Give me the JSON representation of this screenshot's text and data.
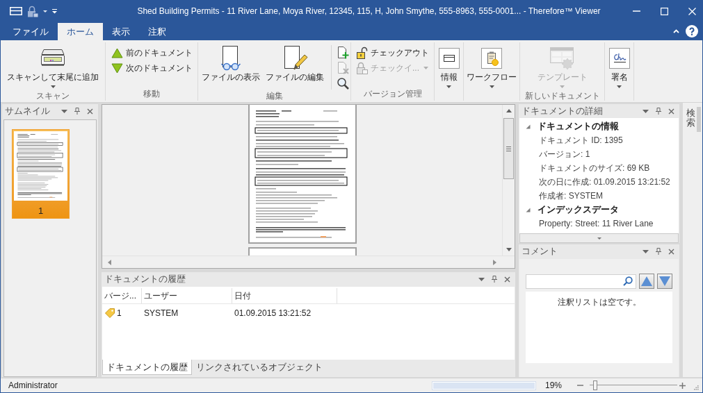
{
  "window": {
    "title": "Shed Building Permits - 11 River Lane, Moya River, 12345, 115, H, John Smythe, 555-8963, 555-0001... - Therefore™ Viewer"
  },
  "ribbon_tabs": [
    {
      "label": "ファイル",
      "selected": false
    },
    {
      "label": "ホーム",
      "selected": true
    },
    {
      "label": "表示",
      "selected": false
    },
    {
      "label": "注釈",
      "selected": false
    }
  ],
  "ribbon_groups": [
    {
      "label": "スキャン",
      "buttons": [
        {
          "kind": "large",
          "label": "スキャンして末尾に追加",
          "dropdown": true,
          "disabled": false
        }
      ]
    },
    {
      "label": "移動",
      "buttons": [
        {
          "kind": "small",
          "label": "前のドキュメント",
          "dropdown": false,
          "disabled": false
        },
        {
          "kind": "small",
          "label": "次のドキュメント",
          "dropdown": false,
          "disabled": false
        }
      ]
    },
    {
      "label": "編集",
      "buttons": [
        {
          "kind": "large",
          "label": "ファイルの表示",
          "dropdown": false,
          "disabled": false
        },
        {
          "kind": "large",
          "label": "ファイルの編集",
          "dropdown": false,
          "disabled": false
        },
        {
          "kind": "icon",
          "dropdown": false,
          "disabled": false
        },
        {
          "kind": "icon",
          "dropdown": false,
          "disabled": true
        },
        {
          "kind": "icon",
          "dropdown": false,
          "disabled": false
        }
      ]
    },
    {
      "label": "バージョン管理",
      "buttons": [
        {
          "kind": "small",
          "label": "チェックアウト",
          "dropdown": false,
          "disabled": false
        },
        {
          "kind": "small",
          "label": "チェックイ...",
          "dropdown": true,
          "disabled": true
        }
      ]
    },
    {
      "buttons": [
        {
          "kind": "large",
          "label": "情報",
          "dropdown": true,
          "disabled": false
        }
      ]
    },
    {
      "buttons": [
        {
          "kind": "large",
          "label": "ワークフロー",
          "dropdown": true,
          "disabled": false
        }
      ]
    },
    {
      "label": "新しいドキュメント",
      "buttons": [
        {
          "kind": "large",
          "label": "テンプレート",
          "dropdown": true,
          "disabled": true
        }
      ]
    },
    {
      "buttons": [
        {
          "kind": "large",
          "label": "署名",
          "dropdown": true,
          "disabled": false
        }
      ]
    }
  ],
  "thumbnails": {
    "title": "サムネイル",
    "pages": [
      {
        "label": "1",
        "selected": true
      }
    ]
  },
  "history": {
    "title": "ドキュメントの履歴",
    "columns": [
      "バージ...",
      "ユーザー",
      "日付"
    ],
    "rows": [
      [
        "1",
        "SYSTEM",
        "01.09.2015 13:21:52"
      ]
    ],
    "tabs": [
      {
        "label": "ドキュメントの履歴",
        "selected": true
      },
      {
        "label": "リンクされているオブジェクト",
        "selected": false
      }
    ]
  },
  "details": {
    "title": "ドキュメントの詳細",
    "tree": [
      {
        "label": "ドキュメントの情報",
        "expanded": true,
        "children": [
          {
            "label": "ドキュメント ID: 1395"
          },
          {
            "label": "バージョン: 1"
          },
          {
            "label": "ドキュメントのサイズ: 69 KB"
          },
          {
            "label": "次の日に作成: 01.09.2015 13:21:52"
          },
          {
            "label": "作成者: SYSTEM"
          }
        ]
      },
      {
        "label": "インデックスデータ",
        "expanded": true,
        "children": [
          {
            "label": "Property: Street: 11 River Lane"
          }
        ]
      }
    ]
  },
  "comments": {
    "title": "コメント",
    "empty_message": "注釈リストは空です。"
  },
  "side_tab": {
    "label": "検索"
  },
  "status_bar": {
    "user": "Administrator",
    "progress": {
      "level": 1
    },
    "zoom": {
      "reading": "19%",
      "level": 0.04
    }
  }
}
